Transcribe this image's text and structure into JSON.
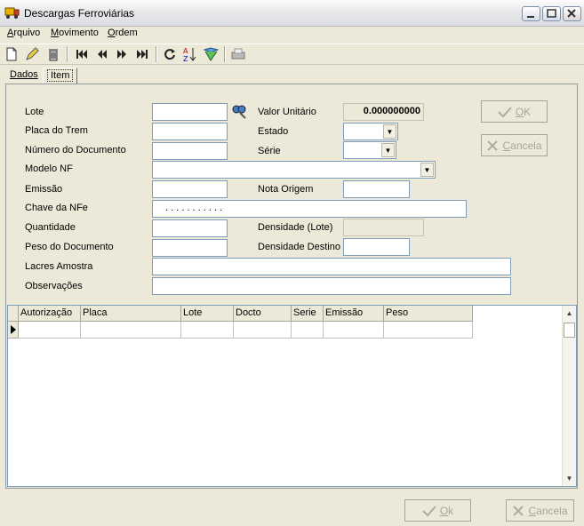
{
  "window": {
    "title": "Descargas Ferroviárias"
  },
  "menu": [
    {
      "label": "Arquivo",
      "mnemonic": "A",
      "rest": "rquivo"
    },
    {
      "label": "Movimento",
      "mnemonic": "M",
      "rest": "ovimento"
    },
    {
      "label": "Ordem",
      "mnemonic": "O",
      "rest": "rdem"
    }
  ],
  "tabs": {
    "dados": "Dados",
    "item": "Item"
  },
  "form": {
    "lote_label": "Lote",
    "placa_label": "Placa do Trem",
    "numdoc_label": "Número do Documento",
    "modelo_label": "Modelo NF",
    "emissao_label": "Emissão",
    "chave_label": "Chave da NFe",
    "quantidade_label": "Quantidade",
    "peso_label": "Peso do Documento",
    "lacres_label": "Lacres Amostra",
    "obs_label": "Observações",
    "valor_label": "Valor Unitário",
    "valor_value": "0.000000000",
    "estado_label": "Estado",
    "serie_label": "Série",
    "nota_origem_label": "Nota Origem",
    "dens_lote_label": "Densidade (Lote)",
    "dens_dest_label": "Densidade Destino",
    "chave_mask": ".  .  .  .  .  .  .  .  .  .  ."
  },
  "side_buttons": {
    "ok": "OK",
    "ok_mn": "O",
    "ok_rest": "K",
    "cancel": "Cancela",
    "cancel_mn": "C",
    "cancel_rest": "ancela"
  },
  "grid": {
    "columns": [
      "Autorização",
      "Placa",
      "Lote",
      "Docto",
      "Serie",
      "Emissão",
      "Peso"
    ]
  },
  "bottom_buttons": {
    "ok": "Ok",
    "ok_mn": "O",
    "ok_rest": "k",
    "cancel": "Cancela",
    "cancel_mn": "C",
    "cancel_rest": "ancela"
  },
  "icons": [
    "truck-icon",
    "new-doc-icon",
    "edit-pencil-icon",
    "trash-icon",
    "first-record-icon",
    "prev-record-icon",
    "next-record-icon",
    "last-record-icon",
    "refresh-icon",
    "sort-az-icon",
    "filter-icon",
    "print-icon",
    "search-binoculars-icon"
  ]
}
